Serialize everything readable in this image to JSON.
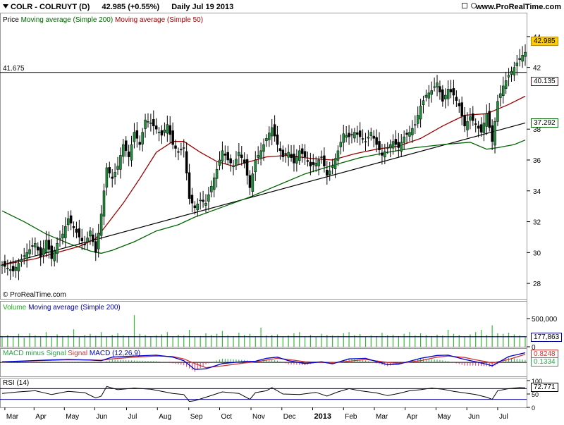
{
  "header": {
    "symbol": "COLR - COLRUYT (D)",
    "last_change": "42.985 (+0.55%)",
    "period": "Daily  Jul 19 2013",
    "site": "www.ProRealTime.com",
    "icons": [
      "tools-icon",
      "settings-icon"
    ]
  },
  "watermark": "© ProRealTime.com",
  "colors": {
    "price_up": "#000000",
    "ma200": "#006400",
    "ma50": "#990000",
    "trendline": "#000000",
    "level_line": "#000000",
    "volume": "#33bb33",
    "volume_ma": "#000099",
    "macd": "#0000cc",
    "signal": "#cc3333",
    "macd_hist": "#22aa44",
    "rsi": "#000000",
    "last_price_badge": "#ffcc00"
  },
  "chart_data": [
    {
      "type": "candlestick",
      "panel": "price",
      "legend": {
        "prefix": "Price",
        "ma200": "Moving average (Simple 200)",
        "ma50": "Moving average (Simple 50)"
      },
      "x_labels": [
        "Mar",
        "Apr",
        "May",
        "Jun",
        "Jul",
        "Aug",
        "Sep",
        "Oct",
        "Nov",
        "Dec",
        "2013",
        "Feb",
        "Mar",
        "Apr",
        "May",
        "Jun",
        "Jul"
      ],
      "ylim": [
        27,
        45
      ],
      "yticks": [
        28,
        30,
        32,
        34,
        36,
        38,
        42,
        44
      ],
      "horizontal_level": {
        "value": 41.675,
        "label": "41.675"
      },
      "trendline": {
        "start": 29.2,
        "end": 38.4
      },
      "price_path": [
        [
          0,
          29.2
        ],
        [
          2,
          28.8
        ],
        [
          4,
          29.8
        ],
        [
          6,
          30.6
        ],
        [
          7,
          29.7
        ],
        [
          8,
          30.8
        ],
        [
          9,
          29.6
        ],
        [
          10,
          30.6
        ],
        [
          11,
          31.2
        ],
        [
          12,
          32.2
        ],
        [
          13,
          31.6
        ],
        [
          14,
          31.0
        ],
        [
          15,
          30.5
        ],
        [
          16,
          31.4
        ],
        [
          17,
          30.0
        ],
        [
          18,
          32.5
        ],
        [
          19,
          35.5
        ],
        [
          20,
          34.8
        ],
        [
          21,
          35.6
        ],
        [
          22,
          37.0
        ],
        [
          23,
          36.2
        ],
        [
          24,
          37.8
        ],
        [
          25,
          37.0
        ],
        [
          26,
          38.6
        ],
        [
          27,
          38.4
        ],
        [
          28,
          38.0
        ],
        [
          29,
          37.6
        ],
        [
          30,
          38.3
        ],
        [
          31,
          37.0
        ],
        [
          32,
          36.5
        ],
        [
          33,
          36.8
        ],
        [
          34,
          33.5
        ],
        [
          35,
          32.9
        ],
        [
          36,
          33.4
        ],
        [
          37,
          33.2
        ],
        [
          38,
          34.3
        ],
        [
          39,
          35.4
        ],
        [
          40,
          36.6
        ],
        [
          41,
          36.0
        ],
        [
          42,
          35.6
        ],
        [
          43,
          36.5
        ],
        [
          44,
          35.8
        ],
        [
          45,
          34.2
        ],
        [
          46,
          36.0
        ],
        [
          47,
          36.6
        ],
        [
          48,
          37.4
        ],
        [
          49,
          38.1
        ],
        [
          50,
          37.0
        ],
        [
          51,
          36.2
        ],
        [
          52,
          36.5
        ],
        [
          53,
          35.8
        ],
        [
          54,
          36.6
        ],
        [
          55,
          36.2
        ],
        [
          56,
          35.6
        ],
        [
          57,
          35.8
        ],
        [
          58,
          36.2
        ],
        [
          59,
          35.0
        ],
        [
          60,
          35.6
        ],
        [
          61,
          36.6
        ],
        [
          62,
          37.7
        ],
        [
          63,
          37.5
        ],
        [
          64,
          37.8
        ],
        [
          65,
          37.5
        ],
        [
          66,
          37.2
        ],
        [
          67,
          37.8
        ],
        [
          68,
          37.0
        ],
        [
          69,
          36.3
        ],
        [
          70,
          36.8
        ],
        [
          71,
          37.2
        ],
        [
          72,
          36.8
        ],
        [
          73,
          37.5
        ],
        [
          74,
          37.8
        ],
        [
          75,
          38.3
        ],
        [
          76,
          39.5
        ],
        [
          77,
          40.2
        ],
        [
          78,
          40.5
        ],
        [
          79,
          41.0
        ],
        [
          80,
          39.8
        ],
        [
          81,
          40.6
        ],
        [
          82,
          40.2
        ],
        [
          83,
          39.5
        ],
        [
          84,
          38.2
        ],
        [
          85,
          38.8
        ],
        [
          86,
          38.3
        ],
        [
          87,
          37.8
        ],
        [
          88,
          39.0
        ],
        [
          89,
          37.2
        ],
        [
          90,
          39.8
        ],
        [
          91,
          40.8
        ],
        [
          92,
          41.5
        ],
        [
          93,
          42.0
        ],
        [
          94,
          42.6
        ],
        [
          95,
          42.985
        ]
      ],
      "ma200": [
        [
          0,
          32.7
        ],
        [
          4,
          32.0
        ],
        [
          8,
          31.2
        ],
        [
          12,
          30.6
        ],
        [
          16,
          30.1
        ],
        [
          18,
          29.95
        ],
        [
          20,
          30.15
        ],
        [
          24,
          30.7
        ],
        [
          28,
          31.4
        ],
        [
          32,
          31.8
        ],
        [
          35,
          32.3
        ],
        [
          40,
          32.95
        ],
        [
          45,
          33.6
        ],
        [
          50,
          34.35
        ],
        [
          55,
          35.1
        ],
        [
          60,
          35.65
        ],
        [
          65,
          36.15
        ],
        [
          70,
          36.5
        ],
        [
          75,
          36.8
        ],
        [
          80,
          37.0
        ],
        [
          85,
          37.15
        ],
        [
          88,
          36.7
        ],
        [
          90,
          36.8
        ],
        [
          93,
          37.0
        ],
        [
          95,
          37.292
        ]
      ],
      "ma50": [
        [
          0,
          29.2
        ],
        [
          6,
          29.6
        ],
        [
          10,
          30.0
        ],
        [
          14,
          30.4
        ],
        [
          17,
          30.9
        ],
        [
          19,
          31.8
        ],
        [
          22,
          33.2
        ],
        [
          25,
          34.8
        ],
        [
          28,
          36.5
        ],
        [
          31,
          37.2
        ],
        [
          33,
          37.2
        ],
        [
          36,
          36.5
        ],
        [
          39,
          35.9
        ],
        [
          42,
          35.6
        ],
        [
          45,
          35.9
        ],
        [
          48,
          36.2
        ],
        [
          52,
          36.3
        ],
        [
          56,
          36.1
        ],
        [
          60,
          36.0
        ],
        [
          64,
          36.4
        ],
        [
          68,
          36.7
        ],
        [
          72,
          36.9
        ],
        [
          76,
          37.4
        ],
        [
          80,
          38.2
        ],
        [
          84,
          38.9
        ],
        [
          88,
          39.0
        ],
        [
          92,
          39.6
        ],
        [
          95,
          40.135
        ]
      ],
      "badges": {
        "last": "42.985",
        "ma50": "40.135",
        "ma200": "37.292"
      }
    },
    {
      "type": "bar",
      "panel": "volume",
      "legend": {
        "prefix": "Volume",
        "ma": "Moving average (Simple 200)"
      },
      "yticks": [
        500000,
        0
      ],
      "ytick_labels": [
        "500,000",
        "0"
      ],
      "ylim": [
        0,
        650000
      ],
      "values": [
        190000,
        210000,
        175000,
        230000,
        160000,
        240000,
        200000,
        185000,
        260000,
        170000,
        220000,
        190000,
        200000,
        310000,
        180000,
        210000,
        230000,
        195000,
        260000,
        175000,
        210000,
        240000,
        200000,
        190000,
        560000,
        230000,
        210000,
        185000,
        200000,
        220000,
        260000,
        180000,
        215000,
        200000,
        300000,
        175000,
        190000,
        240000,
        210000,
        230000,
        280000,
        200000,
        190000,
        250000,
        210000,
        230000,
        185000,
        340000,
        200000,
        210000,
        220000,
        180000,
        200000,
        240000,
        260000,
        190000,
        210000,
        175000,
        230000,
        210000,
        200000,
        195000,
        240000,
        260000,
        210000,
        225000,
        180000,
        200000,
        190000,
        250000,
        205000,
        215000,
        190000,
        230000,
        260000,
        200000,
        240000,
        210000,
        190000,
        215000,
        200000,
        300000,
        230000,
        210000,
        185000,
        220000,
        260000,
        300000,
        210000,
        380000,
        240000,
        230000,
        250000,
        220000,
        200000,
        180000
      ],
      "ma_value": 177863,
      "badge": "177,863"
    },
    {
      "type": "line",
      "panel": "macd",
      "legend": {
        "prefix": "MACD minus Signal",
        "signal": "Signal",
        "macd": "MACD (12,26,9)"
      },
      "ylim": [
        -1.2,
        1.1
      ],
      "macd": [
        [
          0,
          0.05
        ],
        [
          4,
          0.12
        ],
        [
          8,
          0.2
        ],
        [
          12,
          0.25
        ],
        [
          16,
          0.2
        ],
        [
          18,
          0.15
        ],
        [
          20,
          0.45
        ],
        [
          24,
          0.55
        ],
        [
          28,
          0.62
        ],
        [
          31,
          0.45
        ],
        [
          33,
          0.15
        ],
        [
          35,
          -0.6
        ],
        [
          37,
          -0.55
        ],
        [
          40,
          -0.1
        ],
        [
          44,
          0.08
        ],
        [
          46,
          0.1
        ],
        [
          48,
          0.35
        ],
        [
          50,
          0.45
        ],
        [
          52,
          0.15
        ],
        [
          55,
          -0.1
        ],
        [
          58,
          0.05
        ],
        [
          60,
          -0.12
        ],
        [
          63,
          0.3
        ],
        [
          66,
          0.35
        ],
        [
          70,
          -0.2
        ],
        [
          72,
          -0.15
        ],
        [
          76,
          0.35
        ],
        [
          79,
          0.6
        ],
        [
          81,
          0.62
        ],
        [
          84,
          0.25
        ],
        [
          86,
          0.05
        ],
        [
          88,
          -0.15
        ],
        [
          89,
          -0.3
        ],
        [
          92,
          0.5
        ],
        [
          95,
          0.8248
        ]
      ],
      "signal": [
        [
          0,
          0.03
        ],
        [
          4,
          0.1
        ],
        [
          8,
          0.17
        ],
        [
          12,
          0.22
        ],
        [
          16,
          0.21
        ],
        [
          18,
          0.18
        ],
        [
          20,
          0.3
        ],
        [
          24,
          0.45
        ],
        [
          28,
          0.55
        ],
        [
          31,
          0.5
        ],
        [
          33,
          0.3
        ],
        [
          35,
          -0.1
        ],
        [
          37,
          -0.45
        ],
        [
          40,
          -0.3
        ],
        [
          44,
          -0.05
        ],
        [
          46,
          0.05
        ],
        [
          48,
          0.2
        ],
        [
          50,
          0.35
        ],
        [
          52,
          0.25
        ],
        [
          55,
          0.05
        ],
        [
          58,
          0.0
        ],
        [
          60,
          -0.03
        ],
        [
          63,
          0.1
        ],
        [
          66,
          0.25
        ],
        [
          70,
          0.0
        ],
        [
          72,
          -0.08
        ],
        [
          76,
          0.15
        ],
        [
          79,
          0.45
        ],
        [
          81,
          0.55
        ],
        [
          84,
          0.42
        ],
        [
          86,
          0.22
        ],
        [
          88,
          0.05
        ],
        [
          89,
          -0.05
        ],
        [
          92,
          0.25
        ],
        [
          95,
          0.691
        ]
      ],
      "badges": {
        "macd": "0.8248",
        "hist": "0.1334"
      }
    },
    {
      "type": "line",
      "panel": "rsi",
      "legend": "RSI (14)",
      "ylim": [
        0,
        100
      ],
      "yticks": [
        100,
        50,
        0
      ],
      "levels": [
        70,
        30
      ],
      "values": [
        [
          0,
          52
        ],
        [
          3,
          58
        ],
        [
          6,
          62
        ],
        [
          9,
          48
        ],
        [
          12,
          60
        ],
        [
          15,
          55
        ],
        [
          17,
          35
        ],
        [
          18,
          42
        ],
        [
          19,
          78
        ],
        [
          21,
          66
        ],
        [
          24,
          72
        ],
        [
          27,
          68
        ],
        [
          29,
          60
        ],
        [
          31,
          52
        ],
        [
          33,
          48
        ],
        [
          34,
          22
        ],
        [
          35,
          25
        ],
        [
          37,
          38
        ],
        [
          40,
          58
        ],
        [
          43,
          52
        ],
        [
          45,
          30
        ],
        [
          46,
          55
        ],
        [
          48,
          62
        ],
        [
          49,
          74
        ],
        [
          51,
          50
        ],
        [
          54,
          48
        ],
        [
          57,
          56
        ],
        [
          59,
          42
        ],
        [
          61,
          58
        ],
        [
          63,
          70
        ],
        [
          65,
          62
        ],
        [
          68,
          54
        ],
        [
          70,
          44
        ],
        [
          72,
          52
        ],
        [
          74,
          62
        ],
        [
          76,
          66
        ],
        [
          78,
          72
        ],
        [
          80,
          68
        ],
        [
          82,
          60
        ],
        [
          84,
          54
        ],
        [
          86,
          48
        ],
        [
          88,
          38
        ],
        [
          89,
          30
        ],
        [
          90,
          62
        ],
        [
          92,
          70
        ],
        [
          94,
          74
        ],
        [
          95,
          72.771
        ]
      ],
      "badge": "72.771"
    }
  ]
}
